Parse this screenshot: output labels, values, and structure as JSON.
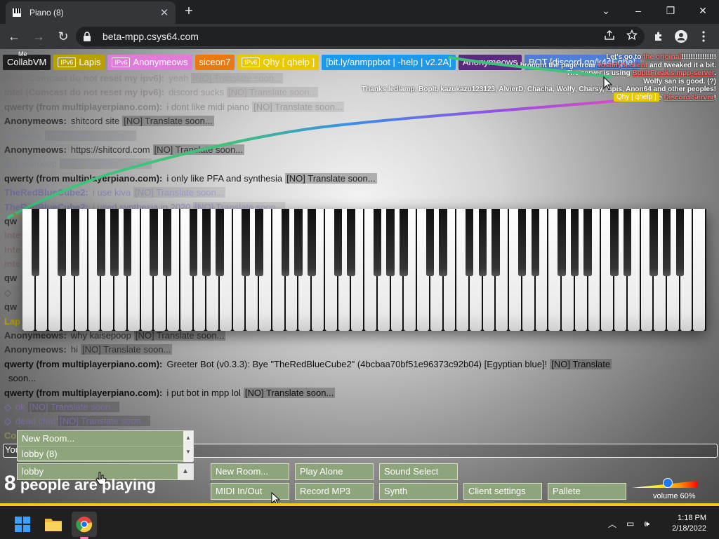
{
  "browser": {
    "tab_title": "Piano (8)",
    "url": "beta-mpp.csys64.com",
    "tab_close": "✕",
    "new_tab": "+",
    "window_controls": {
      "minimize": "–",
      "restore": "❐",
      "close": "✕",
      "tab_search": "⌄"
    }
  },
  "namebar": [
    {
      "name": "CollabVM",
      "color": "#202020",
      "ipv6": false,
      "me": true
    },
    {
      "name": "Lapis",
      "color": "#b8a000",
      "ipv6": true
    },
    {
      "name": "Anonymeows",
      "color": "#e07bdc",
      "ipv6": true
    },
    {
      "name": "siceon7",
      "color": "#e87a10",
      "ipv6": false
    },
    {
      "name": "Qhy [ qhelp ]",
      "color": "#e8c800",
      "ipv6": true
    },
    {
      "name": "[bit.ly/anmppbot | -help | v2.2A]",
      "color": "#1e98e8",
      "ipv6": false
    },
    {
      "name": "Anonymeows",
      "color": "#5a2a80",
      "ipv6": false
    },
    {
      "name": "BOT [discord.gg/k44Eqha]",
      "color": "#4d7fd6",
      "ipv6": false
    }
  ],
  "me_label": "Me",
  "chat": [
    {
      "who": "Intel (Comcast do not reset my ipv6):",
      "msg": "yeah",
      "tr": "[NO] Translate soon...",
      "color": "#7a6a6a",
      "faded": true
    },
    {
      "who": "Intel (Comcast do not reset my ipv6):",
      "msg": "discord sucks",
      "tr": "[NO] Translate soon...",
      "color": "#6a5a5a",
      "faded": true
    },
    {
      "who": "qwerty (from multiplayerpiano.com):",
      "msg": "i dont like midi piano",
      "tr": "[NO] Translate soon...",
      "color": "#333",
      "faded": true
    },
    {
      "who": "Anonymeows:",
      "msg": "shitcord site",
      "tr": "[NO] Translate soon...",
      "color": "#333",
      "faded": false
    },
    {
      "who": "◇",
      "msg": "kaisep",
      "tr": "[NO] Translate soon...",
      "color": "#6a7a9a",
      "faded": true
    },
    {
      "who": "Anonymeows:",
      "msg": "https://shitcord.com",
      "tr": "[NO] Translate soon...",
      "color": "#333",
      "faded": false
    },
    {
      "who": "◇",
      "msg": "kaisepoop",
      "tr": "[NO] Translate soon...",
      "color": "#6a7a9a",
      "faded": true
    },
    {
      "who": "qwerty (from multiplayerpiano.com):",
      "msg": "i only like PFA and synthesia",
      "tr": "[NO] Translate soon...",
      "color": "#222",
      "faded": false
    },
    {
      "who": "TheRedBlueCube2:",
      "msg": "i use kiva",
      "tr": "[NO] Translate soon...",
      "color": "#4040c0",
      "faded": true
    },
    {
      "who": "TheRedBlueCube2:",
      "msg": "i used synthesia in 2020",
      "tr": "[NO] Translate soon...",
      "color": "#4040c0",
      "faded": true
    },
    {
      "who": "qw",
      "msg": "",
      "tr": "",
      "color": "#333",
      "faded": false
    },
    {
      "who": "Inte",
      "msg": "",
      "tr": "",
      "color": "#7a6a6a",
      "faded": false
    },
    {
      "who": "Inte",
      "msg": "",
      "tr": "",
      "color": "#7a6a6a",
      "faded": false
    },
    {
      "who": "Inte",
      "msg": "",
      "tr": "",
      "color": "#7a6a6a",
      "faded": false
    },
    {
      "who": "qw",
      "msg": "",
      "tr": "",
      "color": "#333",
      "faded": false
    },
    {
      "who": "◇",
      "msg": "",
      "tr": "",
      "color": "#333",
      "faded": true
    },
    {
      "who": "qw",
      "msg": "",
      "tr": "",
      "color": "#333",
      "faded": false
    },
    {
      "who": "Lap",
      "msg": "",
      "tr": "",
      "color": "#b8a000",
      "faded": false
    },
    {
      "who": "Anonymeows:",
      "msg": "why kaisepoop",
      "tr": "[NO] Translate soon...",
      "color": "#333",
      "faded": false
    },
    {
      "who": "Anonymeows:",
      "msg": "hi",
      "tr": "[NO] Translate soon...",
      "color": "#333",
      "faded": false
    },
    {
      "who": "qwerty (from multiplayerpiano.com):",
      "msg": "Greeter Bot (v0.3.3): Bye \"TheRedBlueCube2\" (4bcbaa70bf51e96373c92b04) [Egyptian blue]!",
      "tr": "[NO] Translate",
      "color": "#111",
      "faded": false
    },
    {
      "who": "",
      "msg": "soon...",
      "tr": "",
      "color": "#111",
      "faded": false
    },
    {
      "who": "qwerty (from multiplayerpiano.com):",
      "msg": "i put bot in mpp lol",
      "tr": "[NO] Translate soon...",
      "color": "#111",
      "faded": false
    },
    {
      "who": "◇",
      "msg": "ok",
      "tr": "[NO] Translate soon...",
      "color": "#7a6aa0",
      "faded": false
    },
    {
      "who": "◇",
      "msg": "dead chat",
      "tr": "[NO] Translate soon...",
      "color": "#7a6aa0",
      "faded": false
    },
    {
      "who": "CollabVM:",
      "msg": "hi",
      "tr": "[NO] Translate soon...",
      "color": "#8a8a50",
      "faded": false
    }
  ],
  "info": {
    "line1_pre": "Let's go to ",
    "line1_link": "the original",
    "line1_post": "!!!!!!!!!!!!!!!",
    "line2_pre": "I brought the page from ",
    "line2_link": "Yoshify's client",
    "line2_post": " and tweaked it a bit.",
    "line3_pre": "The server is using ",
    "line3_link": "BopItFreak's mpp-server",
    "line3_post": ".",
    "line4": "Wolfy san is good. (?)",
    "line5": "Thanks ledlamp, BopIt, kazukazu123123, AlvierD, Chacha, Wolfy, Charsy, lapis, Anon64 and other peoples!",
    "line6_pre": "Join the ",
    "line6_link": "Discord Server",
    "line6_post": "!"
  },
  "cursor_tag": "Qhy [ qhelp ]",
  "chat_input_placeholder": "You",
  "rooms": [
    "New Room...",
    "lobby (8)"
  ],
  "room_selected": "lobby",
  "playing": {
    "count": "8",
    "text": "people are playing"
  },
  "buttons": {
    "new_room": "New Room...",
    "play_alone": "Play Alone",
    "sound_select": "Sound Select",
    "midi": "MIDI In/Out",
    "record": "Record MP3",
    "synth": "Synth",
    "client_settings": "Client settings",
    "palette": "Pallete"
  },
  "volume": {
    "label": "volume 60%",
    "level": 0.6
  },
  "clock": {
    "time": "1:18 PM",
    "date": "2/18/2022"
  },
  "colors": {
    "accent": "#f5c518",
    "button": "#8ea47a"
  }
}
